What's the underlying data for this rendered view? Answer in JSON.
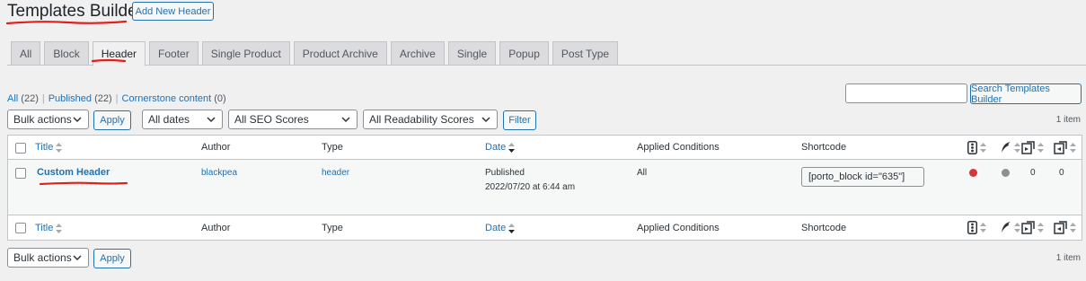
{
  "header": {
    "title": "Templates Builder",
    "add_new_label": "Add New Header"
  },
  "tabs": [
    {
      "label": "All"
    },
    {
      "label": "Block"
    },
    {
      "label": "Header"
    },
    {
      "label": "Footer"
    },
    {
      "label": "Single Product"
    },
    {
      "label": "Product Archive"
    },
    {
      "label": "Archive"
    },
    {
      "label": "Single"
    },
    {
      "label": "Popup"
    },
    {
      "label": "Post Type"
    }
  ],
  "views": {
    "all_label": "All",
    "all_count": "(22)",
    "published_label": "Published",
    "published_count": "(22)",
    "cornerstone_label": "Cornerstone content",
    "cornerstone_count": "(0)",
    "separator": "|"
  },
  "search": {
    "value": "",
    "button_label": "Search Templates Builder"
  },
  "filters": {
    "bulk_actions": "Bulk actions",
    "apply_label": "Apply",
    "dates": "All dates",
    "seo": "All SEO Scores",
    "readability": "All Readability Scores",
    "filter_label": "Filter",
    "items_count": "1 item"
  },
  "table": {
    "columns": {
      "title": "Title",
      "author": "Author",
      "type": "Type",
      "date": "Date",
      "conditions": "Applied Conditions",
      "shortcode": "Shortcode"
    },
    "rows": [
      {
        "title": "Custom Header",
        "author": "blackpea",
        "type": "header",
        "date_status": "Published",
        "date_value": "2022/07/20 at 6:44 am",
        "conditions": "All",
        "shortcode": "[porto_block id=\"635\"]",
        "seo_color": "#d63638",
        "readability_color": "#8c8f94",
        "links_out": "0",
        "links_in": "0"
      }
    ]
  },
  "bottom": {
    "bulk_actions": "Bulk actions",
    "apply_label": "Apply",
    "items_count": "1 item"
  }
}
